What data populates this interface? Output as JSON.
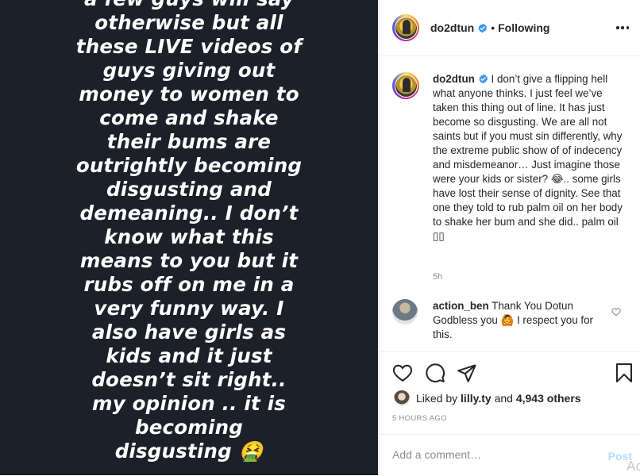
{
  "story": {
    "lines": [
      "a few guys will say",
      "otherwise but all",
      "these LIVE videos of",
      "guys giving out",
      "money to women to",
      "come and shake",
      "their bums are",
      "outrightly becoming",
      "disgusting and",
      "demeaning.. I don’t",
      "know what this",
      "means to you but it",
      "rubs off on me in a",
      "very funny way. I",
      "also have girls as",
      "kids and it just",
      "doesn’t sit right..",
      "my opinion .. it is",
      "becoming",
      "disgusting 🤮"
    ]
  },
  "header": {
    "username": "do2dtun",
    "separator": "•",
    "follow_status": "Following"
  },
  "caption": {
    "username": "do2dtun",
    "text": "I don’t give a flipping hell what anyone thinks. I just feel we’ve taken this thing out of line. It has just become so disgusting. We are all not saints but if you must sin differently, why the extreme public show of of indecency and misdemeanor… Just imagine those were your kids or sister? 😂.. some girls have lost their sense of dignity. See that one they told to rub palm oil on her body to shake her bum and she did.. palm oil ▯▯",
    "time": "5h"
  },
  "comment": {
    "username": "action_ben",
    "text": "Thank You Dotun Godbless you 🙆 I respect you for this."
  },
  "likes": {
    "prefix": "Liked by",
    "user": "lilly.ty",
    "and": "and",
    "count": "4,943 others"
  },
  "timestamp": "5 HOURS AGO",
  "add_comment": {
    "placeholder": "Add a comment…",
    "post_label": "Post"
  },
  "overlay_text": "Ac",
  "colors": {
    "verified": "#3897f0",
    "post_button_disabled": "#b2dffc",
    "story_background": "#1c2029"
  }
}
